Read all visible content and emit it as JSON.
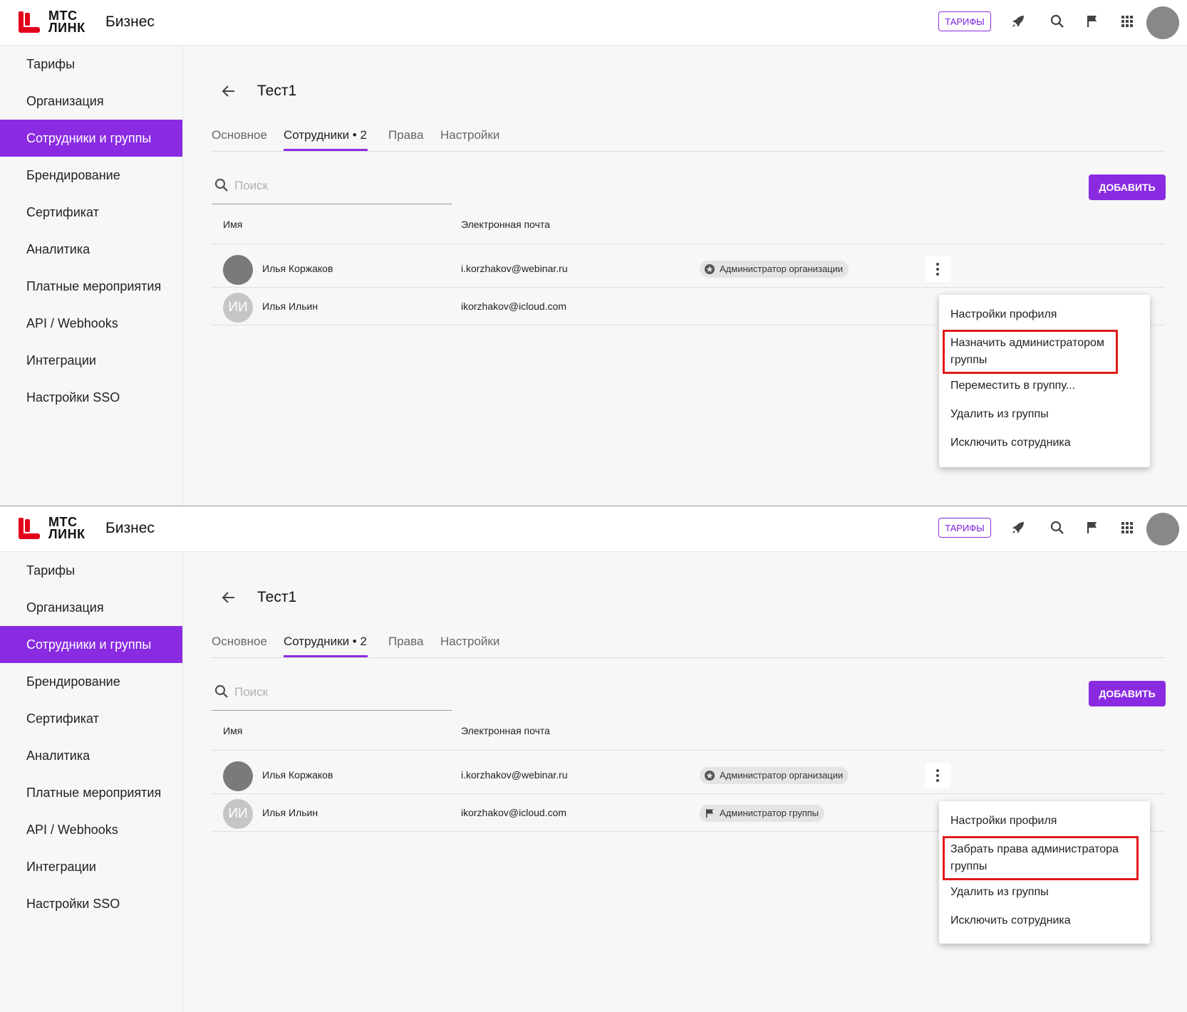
{
  "colors": {
    "accent": "#8a2be2",
    "highlight": "#e01b1b",
    "logo_red": "#e3001b"
  },
  "header": {
    "logo_line1": "МТС",
    "logo_line2": "ЛИНК",
    "brand": "Бизнес",
    "tariffs_button": "ТАРИФЫ",
    "icons": [
      "rocket-icon",
      "search-icon",
      "flag-icon",
      "apps-grid-icon",
      "user-avatar"
    ]
  },
  "sidebar": {
    "items": [
      {
        "label": "Тарифы"
      },
      {
        "label": "Организация"
      },
      {
        "label": "Сотрудники и группы",
        "active": true
      },
      {
        "label": "Брендирование"
      },
      {
        "label": "Сертификат"
      },
      {
        "label": "Аналитика"
      },
      {
        "label": "Платные мероприятия"
      },
      {
        "label": "API / Webhooks"
      },
      {
        "label": "Интеграции"
      },
      {
        "label": "Настройки SSO"
      }
    ]
  },
  "page": {
    "title": "Тест1",
    "tabs": [
      {
        "label": "Основное"
      },
      {
        "label": "Сотрудники • 2",
        "active": true
      },
      {
        "label": "Права"
      },
      {
        "label": "Настройки"
      }
    ],
    "search_placeholder": "Поиск",
    "add_button": "ДОБАВИТЬ",
    "columns": {
      "name": "Имя",
      "email": "Электронная почта"
    }
  },
  "screen1": {
    "rows": [
      {
        "avatar": "",
        "name": "Илья Коржаков",
        "email": "i.korzhakov@webinar.ru",
        "badge": "Администратор организации"
      },
      {
        "avatar": "ИИ",
        "name": "Илья Ильин",
        "email": "ikorzhakov@icloud.com",
        "badge": ""
      }
    ],
    "menu": [
      "Настройки профиля",
      "Назначить администратором группы",
      "Переместить в группу...",
      "Удалить из группы",
      "Исключить сотрудника"
    ]
  },
  "screen2": {
    "rows": [
      {
        "avatar": "",
        "name": "Илья Коржаков",
        "email": "i.korzhakov@webinar.ru",
        "badge": "Администратор организации"
      },
      {
        "avatar": "ИИ",
        "name": "Илья Ильин",
        "email": "ikorzhakov@icloud.com",
        "badge": "Администратор группы"
      }
    ],
    "menu": [
      "Настройки профиля",
      "Забрать права администратора группы",
      "Удалить из группы",
      "Исключить сотрудника"
    ]
  }
}
